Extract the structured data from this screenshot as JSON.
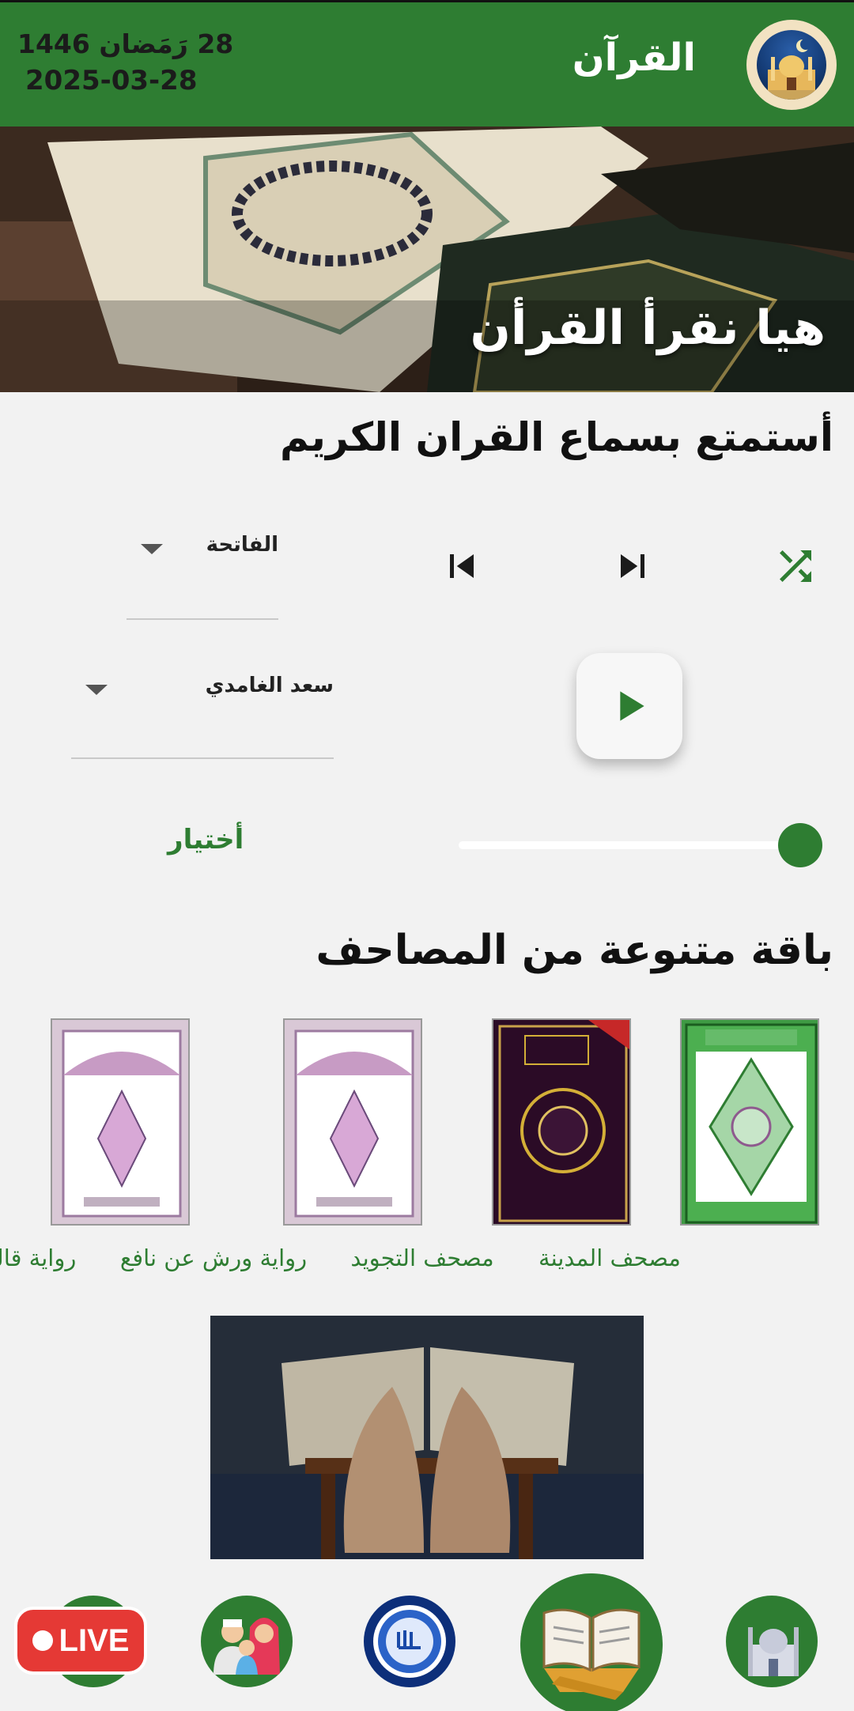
{
  "header": {
    "title": "القرآن",
    "hijri_date": "28 رَمَضان 1446",
    "gregorian_date": "2025-03-28"
  },
  "hero": {
    "title": "هيا نقرأ القرأن"
  },
  "player": {
    "section_title": "أستمتع بسماع القران الكريم",
    "surah_selected": "الفاتحة",
    "reciter_selected": "سعد الغامدي",
    "choose_label": "أختيار",
    "progress_fraction": 1.0
  },
  "mushafs": {
    "section_title": "باقة متنوعة من المصاحف",
    "items": [
      {
        "label": "مصحف المدينة"
      },
      {
        "label": "مصحف التجويد"
      },
      {
        "label": "رواية ورش عن نافع"
      },
      {
        "label": "رواية قالون عن نافع"
      }
    ]
  },
  "bottom_nav": {
    "live_label": "LIVE",
    "items": [
      "mosque-icon",
      "quran-book-icon",
      "allah-medallion-icon",
      "family-icon",
      "live-badge-icon"
    ]
  },
  "colors": {
    "primary": "#2e7d32",
    "background": "#f2f2f2",
    "live": "#e53935"
  }
}
